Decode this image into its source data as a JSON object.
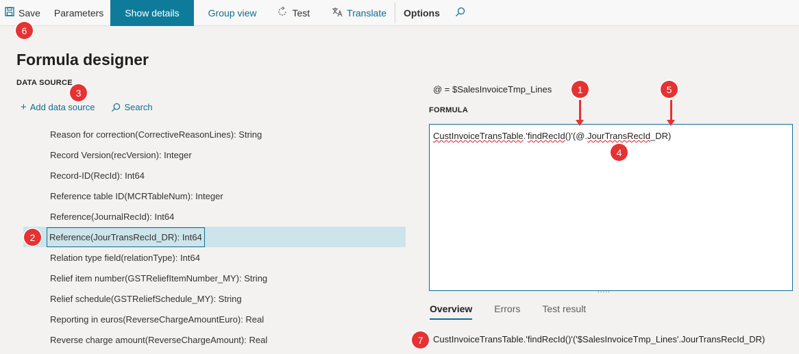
{
  "toolbar": {
    "save_label": "Save",
    "parameters_label": "Parameters",
    "show_details_label": "Show details",
    "group_view_label": "Group view",
    "test_label": "Test",
    "translate_label": "Translate",
    "options_label": "Options",
    "icons": {
      "save": "save-icon",
      "test": "refresh-icon",
      "translate": "translate-icon",
      "search": "search-icon"
    }
  },
  "page": {
    "title": "Formula designer"
  },
  "data_source": {
    "header": "DATA SOURCE",
    "add_label": "Add data source",
    "search_label": "Search",
    "items": [
      {
        "label": "Reason for correction(CorrectiveReasonLines): String"
      },
      {
        "label": "Record Version(recVersion): Integer"
      },
      {
        "label": "Record-ID(RecId): Int64"
      },
      {
        "label": "Reference table ID(MCRTableNum): Integer"
      },
      {
        "label": "Reference(JournalRecId): Int64"
      },
      {
        "label": "Reference(JourTransRecId_DR): Int64",
        "selected": true
      },
      {
        "label": "Relation type field(relationType): Int64"
      },
      {
        "label": "Relief item number(GSTReliefItemNumber_MY): String"
      },
      {
        "label": "Relief schedule(GSTReliefSchedule_MY): String"
      },
      {
        "label": "Reporting in euros(ReverseChargeAmountEuro): Real"
      },
      {
        "label": "Reverse charge amount(ReverseChargeAmount): Real"
      }
    ]
  },
  "formula": {
    "context": "@ = $SalesInvoiceTmp_Lines",
    "header": "FORMULA",
    "part1": "CustInvoiceTransTable",
    "part2": ".'",
    "part3": "findRecId",
    "part4": "()'",
    "part5": "(@.",
    "part6": "JourTransRecId",
    "part7": "_DR)",
    "grip": "....."
  },
  "result_tabs": {
    "tabs": [
      "Overview",
      "Errors",
      "Test result"
    ],
    "active": "Overview"
  },
  "overview_text": "CustInvoiceTransTable.'findRecId()'('$SalesInvoiceTmp_Lines'.JourTransRecId_DR)",
  "callouts": [
    "1",
    "2",
    "3",
    "4",
    "5",
    "6",
    "7"
  ],
  "colors": {
    "accent": "#0f7b9a",
    "link": "#0f6c8d",
    "callout": "#e53232",
    "selected_row": "#cce4ea"
  }
}
